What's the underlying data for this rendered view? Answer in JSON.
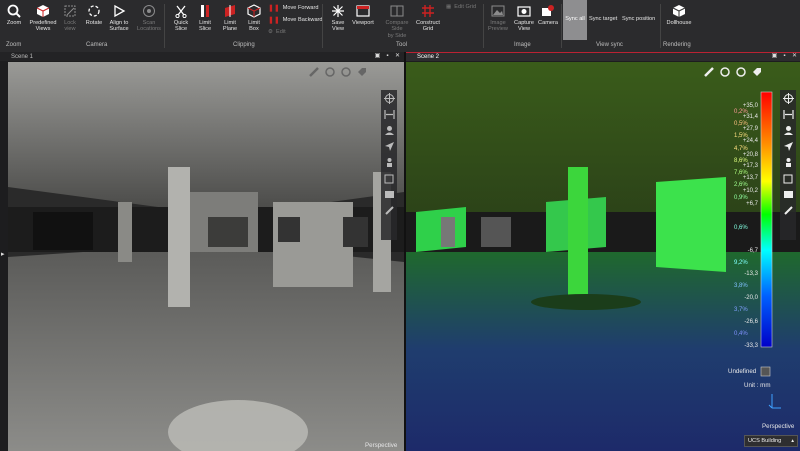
{
  "ribbon": {
    "zoom": "Zoom",
    "predefined_views": "Predefined\nViews",
    "lock_view": "Lock\nview",
    "rotate": "Rotate",
    "align_to_surface": "Align to\nSurface",
    "scan_locations": "Scan\nLocations",
    "quick_slice": "Quick\nSlice",
    "limit_slice": "Limit\nSlice",
    "limit_plane": "Limit\nPlane",
    "limit_box": "Limit\nBox",
    "move_forward": "Move Forward",
    "move_backward": "Move Backward",
    "edit": "Edit",
    "save_view": "Save\nView",
    "viewport": "Viewport",
    "compare_side_by_side": "Compare Side\nby Side",
    "construct_grid": "Construct\nGrid",
    "edit_grid": "Edit Grid",
    "image_preview": "Image\nPreview",
    "capture_view": "Capture\nView",
    "camera": "Camera",
    "sync_all": "Sync all",
    "sync_target": "Sync target",
    "sync_position": "Sync position",
    "dollhouse": "Dollhouse",
    "groups": {
      "zoom": "Zoom",
      "camera": "Camera",
      "clipping": "Clipping",
      "tool": "Tool",
      "image": "Image",
      "view_sync": "View sync",
      "rendering": "Rendering"
    }
  },
  "scene1": {
    "title": "Scene 1",
    "mode": "Perspective"
  },
  "scene2": {
    "title": "Scene 2",
    "mode": "Perspective",
    "undefined_label": "Undefined",
    "unit_label": "Unit : mm",
    "ucs": "UCS Building",
    "scale_values": [
      "+35,0",
      "+31,4",
      "+27,9",
      "+24,4",
      "+20,8",
      "+17,3",
      "+13,7",
      "+10,2",
      "+6,7",
      "-6,7",
      "-13,3",
      "-20,0",
      "-26,6",
      "-33,3"
    ],
    "deviation_labels": [
      "0,2%",
      "0,5%",
      "1,5%",
      "4,7%",
      "8,6%",
      "7,6%",
      "2,6%",
      "0,9%",
      "0,6%",
      "9,2%",
      "3,8%",
      "3,7%",
      "0,4%"
    ]
  },
  "colors": {
    "accent": "#bb2233",
    "ribbon_bg": "#2b2b2d",
    "sync_all_bg": "#8e8e90"
  }
}
